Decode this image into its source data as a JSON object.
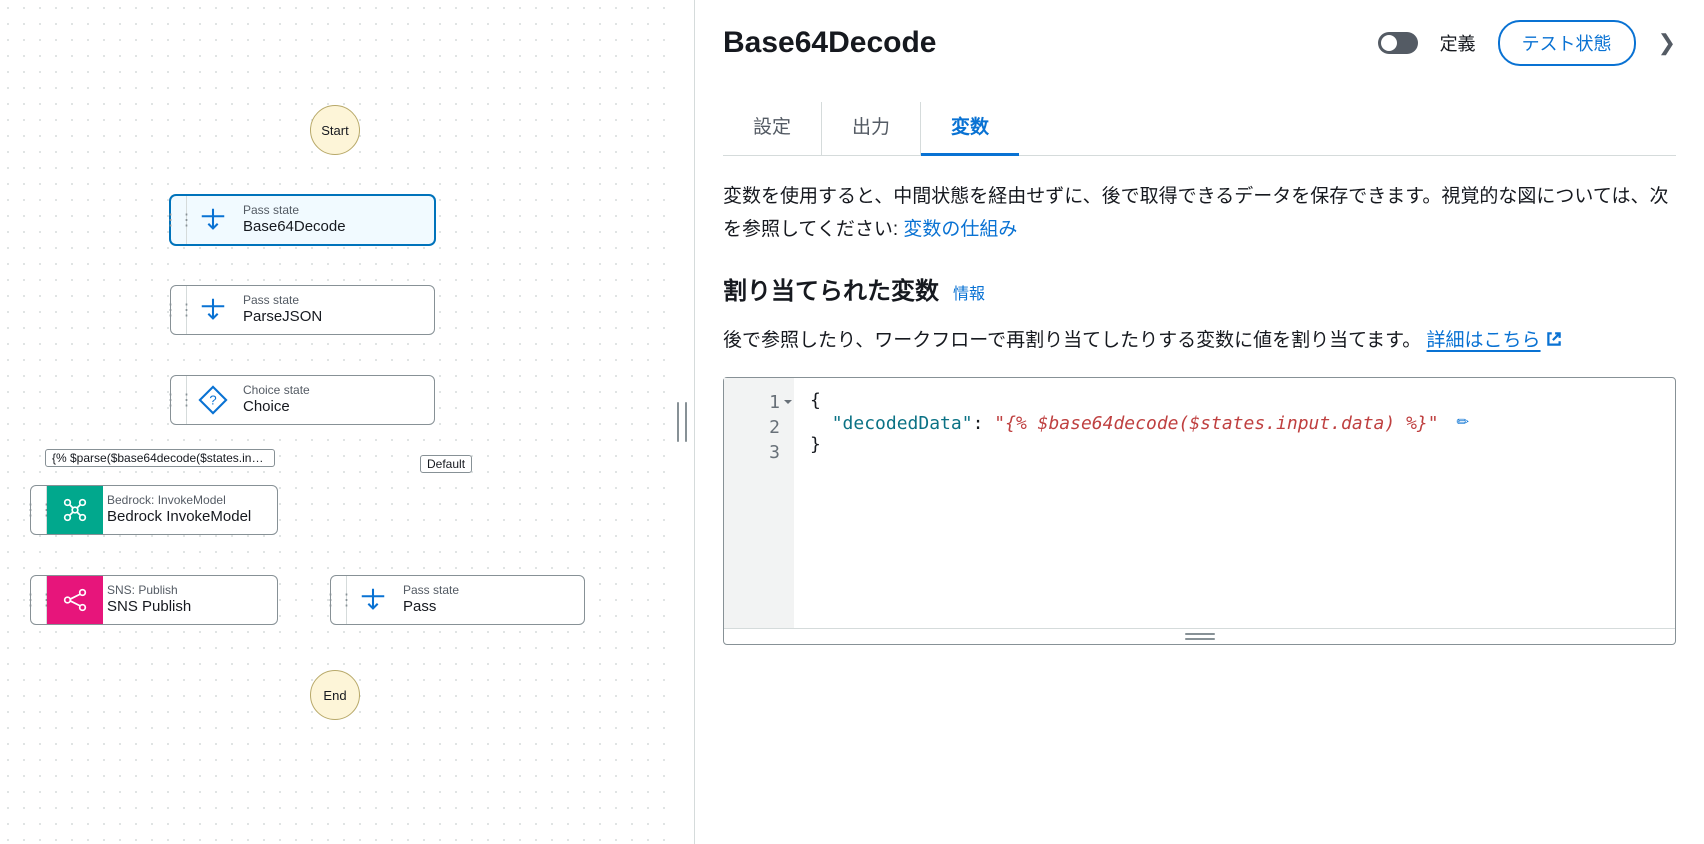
{
  "workflow": {
    "start_label": "Start",
    "end_label": "End",
    "nodes": {
      "b64": {
        "type": "Pass state",
        "title": "Base64Decode"
      },
      "parse": {
        "type": "Pass state",
        "title": "ParseJSON"
      },
      "choice": {
        "type": "Choice state",
        "title": "Choice"
      },
      "bedrock": {
        "type": "Bedrock: InvokeModel",
        "title": "Bedrock InvokeModel"
      },
      "sns": {
        "type": "SNS: Publish",
        "title": "SNS Publish"
      },
      "pass": {
        "type": "Pass state",
        "title": "Pass"
      }
    },
    "choice_rule_badge": "{% $parse($base64decode($states.input...",
    "default_badge": "Default"
  },
  "panel": {
    "title": "Base64Decode",
    "definition_toggle_label": "定義",
    "test_button": "テスト状態",
    "tabs": {
      "config": "設定",
      "output": "出力",
      "variables": "変数"
    },
    "intro_text": "変数を使用すると、中間状態を経由せずに、後で取得できるデータを保存できます。視覚的な図については、次を参照してください: ",
    "intro_link": "変数の仕組み",
    "section_heading": "割り当てられた変数",
    "section_info": "情報",
    "assign_text_1": "後で参照したり、ワークフローで再割り当てしたりする変数に値を割り当てます。",
    "assign_link": "詳細はこちら",
    "editor": {
      "line1": "{",
      "key": "\"decodedData\"",
      "colon": ": ",
      "value": "\"{% $base64decode($states.input.data) %}\"",
      "line3": "}"
    }
  }
}
